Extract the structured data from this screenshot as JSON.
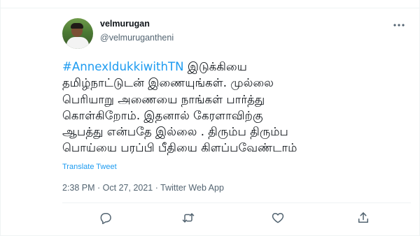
{
  "author": {
    "display_name": "velmurugan",
    "handle": "@velmurugantheni"
  },
  "tweet": {
    "hashtag": "#AnnexIdukkiwithTN",
    "text_first_line_rest": " இடுக்கியை",
    "text_lines": [
      "தமிழ்நாட்டுடன் இணையுங்கள். முல்லை",
      "பெரியாறு அணையை நாங்கள் பார்த்து",
      "கொள்கிறோம். இதனால் கேரளாவிற்கு",
      "ஆபத்து என்பதே இல்லை . திரும்ப திரும்ப",
      "பொய்யை பரப்பி பீதியை கிளப்பவேண்டாம்"
    ],
    "translate_label": "Translate Tweet",
    "time": "2:38 PM",
    "date": "Oct 27, 2021",
    "source": "Twitter Web App",
    "separator": " · "
  },
  "icons": {
    "more": "more-options-icon",
    "reply": "reply-icon",
    "retweet": "retweet-icon",
    "like": "like-icon",
    "share": "share-icon"
  },
  "colors": {
    "link": "#1d9bf0",
    "secondary_text": "#536471",
    "primary_text": "#0f1419",
    "divider": "#eff3f4"
  }
}
